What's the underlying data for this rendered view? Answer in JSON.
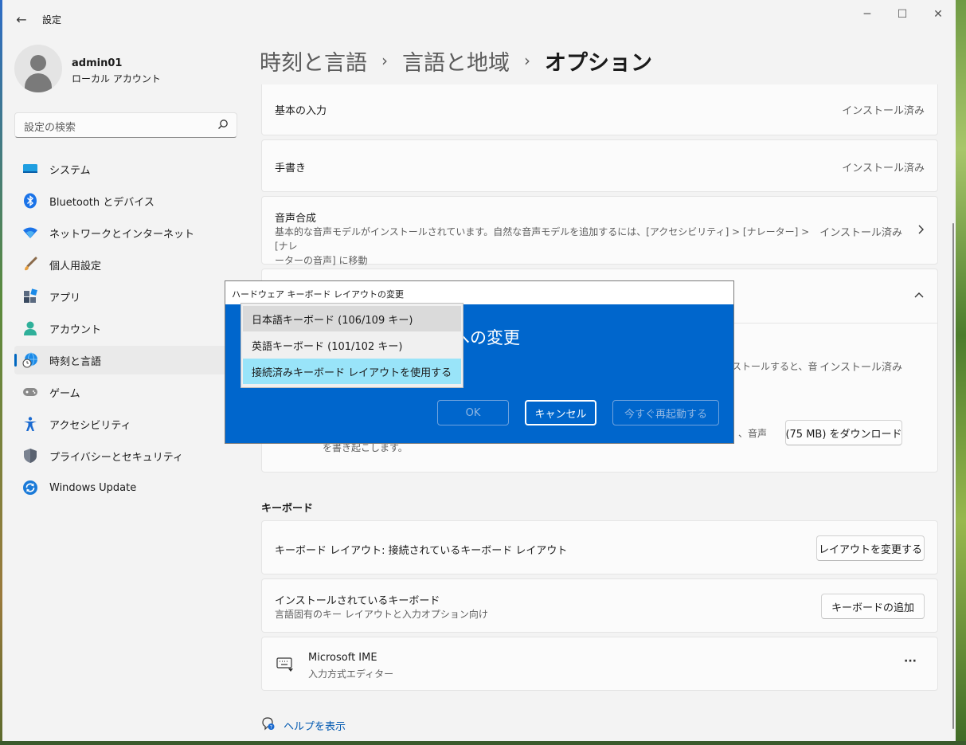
{
  "window": {
    "title": "設定",
    "back_icon": "←",
    "min_icon": "─",
    "max_icon": "☐",
    "close_icon": "✕"
  },
  "profile": {
    "name": "admin01",
    "account_type": "ローカル アカウント"
  },
  "search": {
    "placeholder": "設定の検索",
    "icon": "⚲"
  },
  "sidebar": {
    "items": [
      {
        "label": "システム",
        "icon": "monitor-icon",
        "active": false
      },
      {
        "label": "Bluetooth とデバイス",
        "icon": "bluetooth-icon",
        "active": false
      },
      {
        "label": "ネットワークとインターネット",
        "icon": "wifi-icon",
        "active": false
      },
      {
        "label": "個人用設定",
        "icon": "brush-icon",
        "active": false
      },
      {
        "label": "アプリ",
        "icon": "apps-icon",
        "active": false
      },
      {
        "label": "アカウント",
        "icon": "person-icon",
        "active": false
      },
      {
        "label": "時刻と言語",
        "icon": "globe-clock-icon",
        "active": true
      },
      {
        "label": "ゲーム",
        "icon": "gamepad-icon",
        "active": false
      },
      {
        "label": "アクセシビリティ",
        "icon": "accessibility-icon",
        "active": false
      },
      {
        "label": "プライバシーとセキュリティ",
        "icon": "shield-icon",
        "active": false
      },
      {
        "label": "Windows Update",
        "icon": "update-icon",
        "active": false
      }
    ]
  },
  "breadcrumb": {
    "level1": "時刻と言語",
    "level2": "言語と地域",
    "current": "オプション",
    "separator": "›"
  },
  "cards": {
    "basic_input": {
      "title": "基本の入力",
      "status": "インストール済み"
    },
    "handwriting": {
      "title": "手書き",
      "status": "インストール済み"
    },
    "speech": {
      "title": "音声合成",
      "desc_line1": "基本的な音声モデルがインストールされています。自然な音声モデルを追加するには、[アクセシビリティ] > [ナレーター] > [ナレ",
      "desc_line2": "ーターの音声] に移動",
      "status": "インストール済み"
    },
    "speech_recognition": {
      "partial_desc_1": "ストールすると、音",
      "status": "インストール済み",
      "partial_desc_2": "、音声",
      "partial_desc_3": "を書き起こします。",
      "download_button": "(75 MB) をダウンロード"
    }
  },
  "keyboard_section": {
    "heading": "キーボード",
    "layout": {
      "title": "キーボード レイアウト: 接続されているキーボード レイアウト",
      "button": "レイアウトを変更する"
    },
    "installed": {
      "title": "インストールされているキーボード",
      "desc": "言語固有のキー レイアウトと入力オプション向け",
      "button": "キーボードの追加"
    },
    "ime": {
      "title": "Microsoft IME",
      "desc": "入力方式エディター",
      "more": "···"
    }
  },
  "help": {
    "label": "ヘルプを表示"
  },
  "dialog": {
    "title": "ハードウェア キーボード レイアウトの変更",
    "heading_partial": "への変更",
    "ok_button": "OK",
    "cancel_button": "キャンセル",
    "restart_button": "今すぐ再起動する",
    "dropdown_options": [
      {
        "label": "日本語キーボード (106/109 キー)",
        "state": "hover"
      },
      {
        "label": "英語キーボード (101/102 キー)",
        "state": "normal"
      },
      {
        "label": "接続済みキーボード レイアウトを使用する",
        "state": "selected"
      }
    ]
  },
  "colors": {
    "accent": "#0067c0",
    "dialog_blue": "#0066cc",
    "selected_option": "#99e4f9"
  }
}
